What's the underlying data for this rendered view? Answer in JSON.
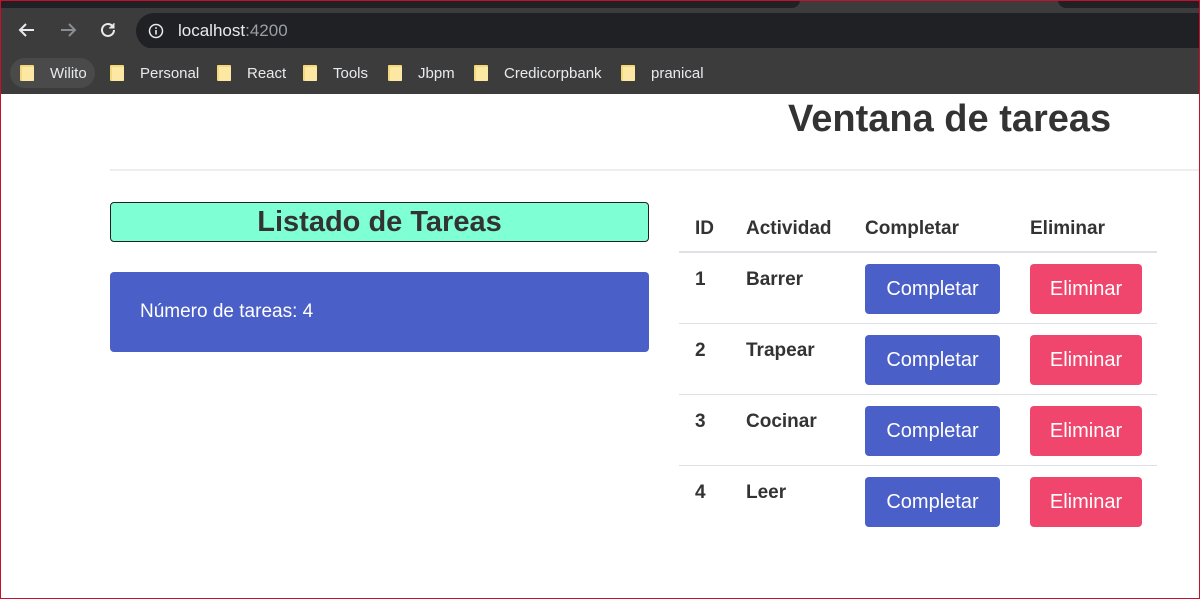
{
  "browser": {
    "url_host": "localhost",
    "url_port": ":4200",
    "bookmarks": [
      "Wilito",
      "Personal",
      "React",
      "Tools",
      "Jbpm",
      "Credicorpbank",
      "pranical"
    ]
  },
  "page": {
    "title": "Ventana de tareas",
    "list_header": "Listado de Tareas",
    "count_text": "Número de tareas: 4"
  },
  "table": {
    "headers": {
      "id": "ID",
      "activity": "Actividad",
      "complete": "Completar",
      "delete": "Eliminar"
    },
    "rows": [
      {
        "id": "1",
        "activity": "Barrer",
        "complete_label": "Completar",
        "delete_label": "Eliminar"
      },
      {
        "id": "2",
        "activity": "Trapear",
        "complete_label": "Completar",
        "delete_label": "Eliminar"
      },
      {
        "id": "3",
        "activity": "Cocinar",
        "complete_label": "Completar",
        "delete_label": "Eliminar"
      },
      {
        "id": "4",
        "activity": "Leer",
        "complete_label": "Completar",
        "delete_label": "Eliminar"
      }
    ]
  },
  "colors": {
    "accent_blue": "#4a5fc8",
    "danger_pink": "#f0456c",
    "header_aquamarine": "#7fffd4"
  }
}
